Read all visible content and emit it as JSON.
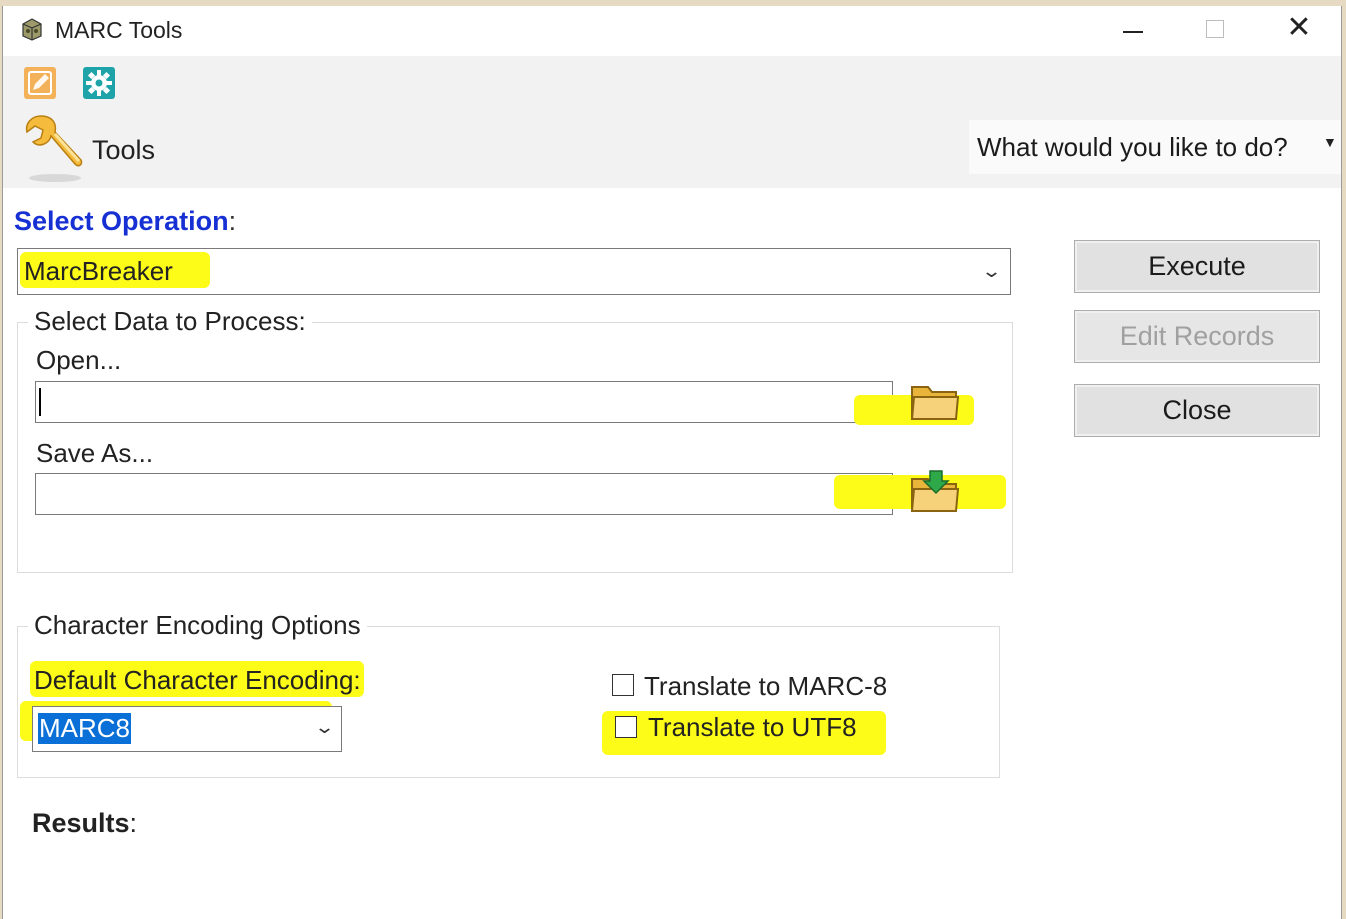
{
  "window": {
    "title": "MARC Tools",
    "controls": {
      "minimize": "–",
      "maximize": "□",
      "close": "✕"
    }
  },
  "ribbon": {
    "quick_access": [
      {
        "icon": "edit-icon",
        "color": "#f3b25a"
      },
      {
        "icon": "gear-icon",
        "color": "#1ea3a8"
      }
    ],
    "tools_label": "Tools",
    "help_search": "What would you like to do?"
  },
  "operation": {
    "label": "Select Operation",
    "colon": ":",
    "selected": "MarcBreaker"
  },
  "buttons": {
    "execute": "Execute",
    "edit_records": "Edit Records",
    "close": "Close"
  },
  "data_group": {
    "title": "Select Data to Process:",
    "open_label": "Open...",
    "open_value": "",
    "save_label": "Save As...",
    "save_value": ""
  },
  "encoding_group": {
    "title": "Character Encoding Options",
    "default_label": "Default Character Encoding",
    "colon": ":",
    "selected": "MARC8",
    "translate_marc8": {
      "label": "Translate to MARC-8",
      "checked": false
    },
    "translate_utf8": {
      "label": "Translate to UTF8",
      "checked": false
    }
  },
  "results": {
    "label": "Results",
    "colon": ":"
  },
  "colors": {
    "highlight": "#fdfb18",
    "operation_label": "#1730d4",
    "selection": "#0a6fd6",
    "window_border": "#e6dac2"
  }
}
